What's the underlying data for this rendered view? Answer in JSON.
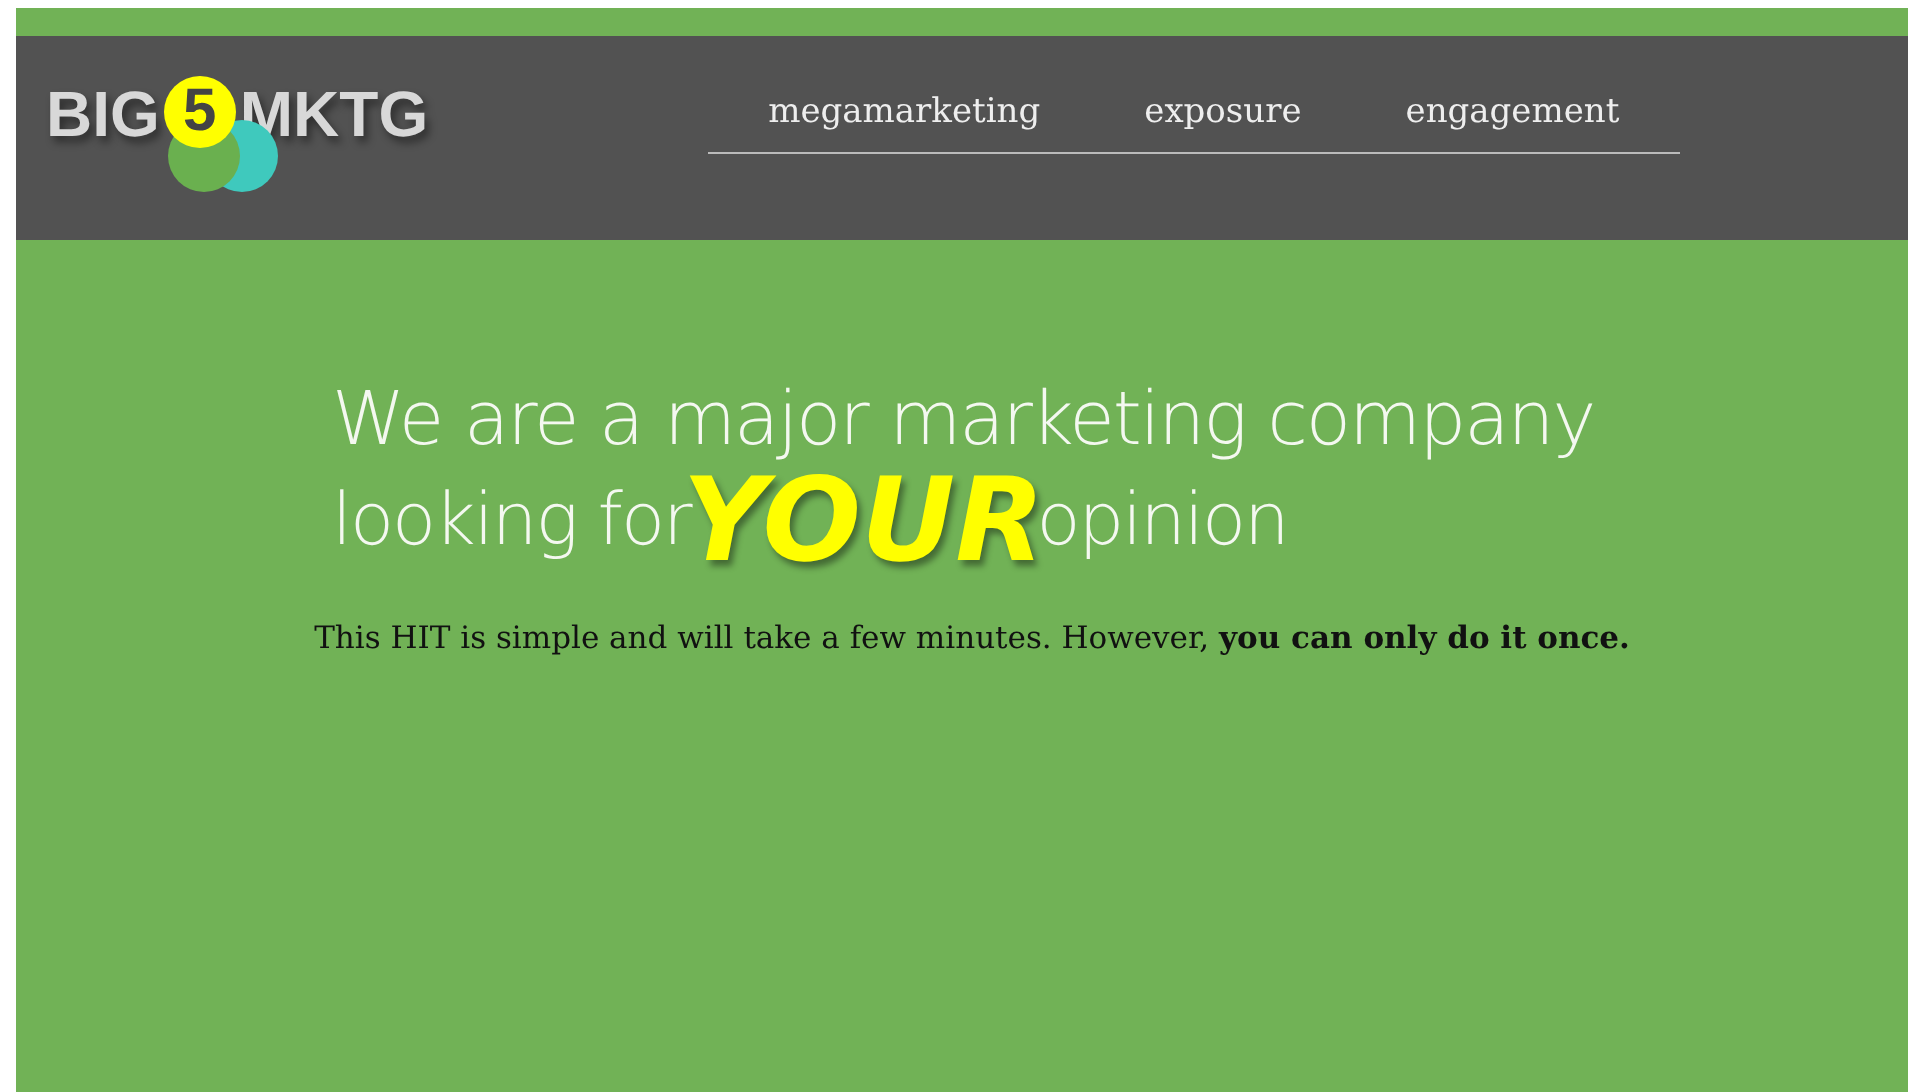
{
  "logo": {
    "before": "BIG",
    "number": "5",
    "after": "MKTG"
  },
  "nav": {
    "items": [
      "megamarketing",
      "exposure",
      "engagement"
    ]
  },
  "headline": {
    "line_1": "We are a major marketing company",
    "line_2_start": "looking for",
    "emphasis": "YOUR",
    "line_2_end": "opinion"
  },
  "intro": "This HIT is simple and will take a few minutes. However, **you can only do it once.**"
}
